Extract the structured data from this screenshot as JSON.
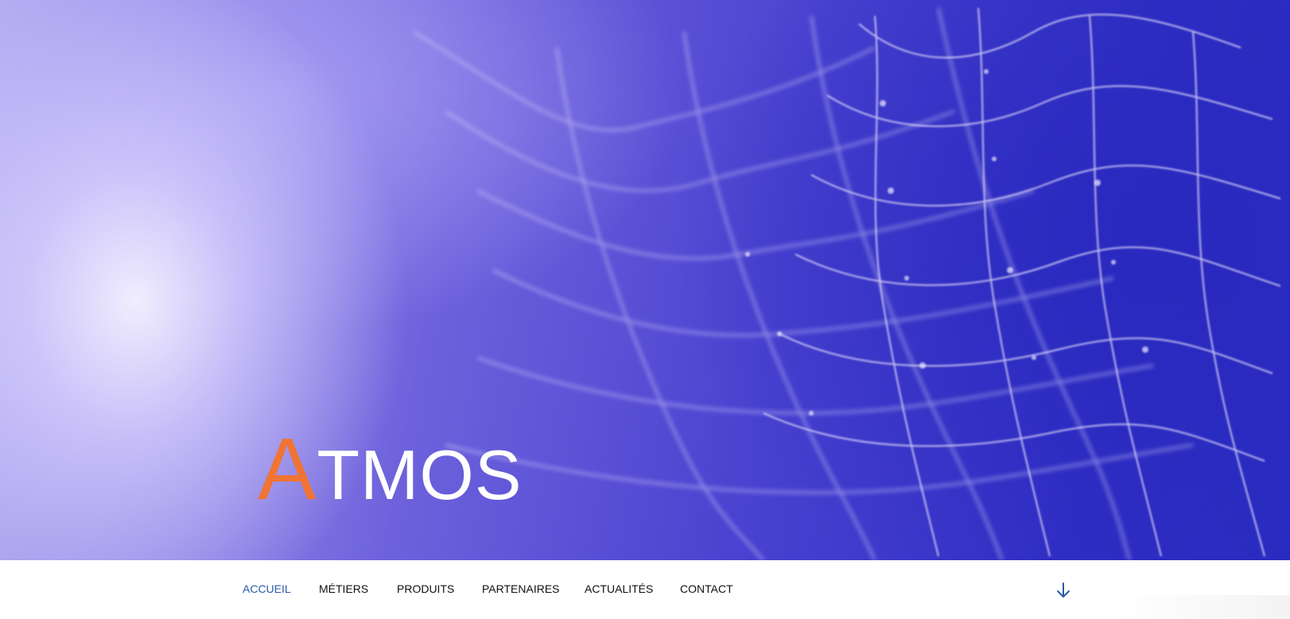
{
  "brand": {
    "initial": "A",
    "rest": "TMOS"
  },
  "nav": {
    "items": [
      {
        "label": "ACCUEIL",
        "active": true
      },
      {
        "label": "MÉTIERS",
        "active": false
      },
      {
        "label": "PRODUITS",
        "active": false
      },
      {
        "label": "PARTENAIRES",
        "active": false
      },
      {
        "label": "ACTUALITÉS",
        "active": false
      },
      {
        "label": "CONTACT",
        "active": false
      }
    ],
    "scroll_icon": "arrow-down-icon"
  },
  "colors": {
    "accent": "#f07434",
    "active_nav": "#2b5aa8",
    "hero_blue": "#3a36c8"
  }
}
